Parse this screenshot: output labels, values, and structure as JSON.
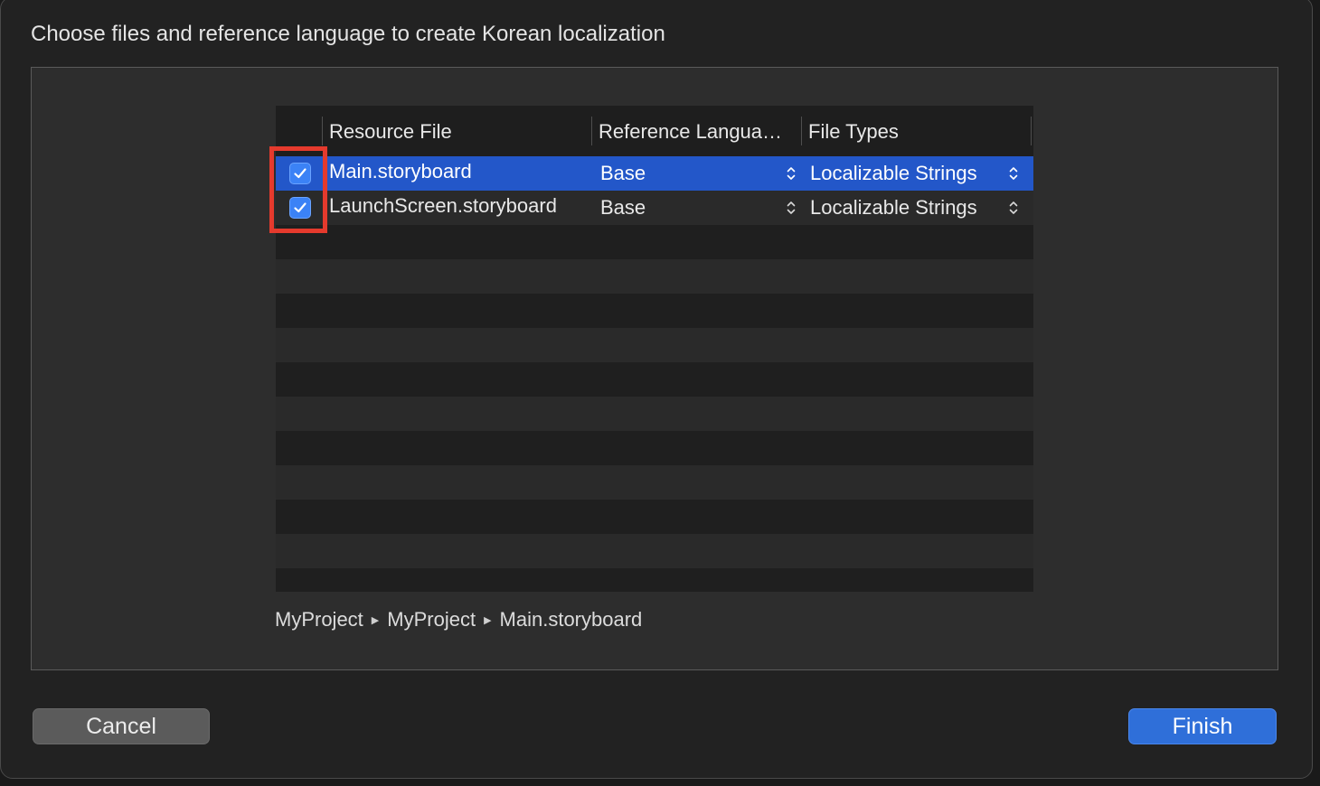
{
  "dialog": {
    "title": "Choose files and reference language to create Korean localization"
  },
  "table": {
    "columns": {
      "resource_file": "Resource File",
      "reference_language": "Reference Langua…",
      "file_types": "File Types"
    },
    "rows": [
      {
        "checked": true,
        "resource_file": "Main.storyboard",
        "reference_language": "Base",
        "file_type": "Localizable Strings",
        "selected": true
      },
      {
        "checked": true,
        "resource_file": "LaunchScreen.storyboard",
        "reference_language": "Base",
        "file_type": "Localizable Strings",
        "selected": false
      }
    ]
  },
  "path": {
    "segments": [
      "MyProject",
      "MyProject",
      "Main.storyboard"
    ]
  },
  "buttons": {
    "cancel": "Cancel",
    "finish": "Finish"
  },
  "colors": {
    "selection": "#2357c9",
    "checkbox": "#3b82f6",
    "finish_button": "#2f6fd9",
    "highlight": "#e53a2d"
  }
}
